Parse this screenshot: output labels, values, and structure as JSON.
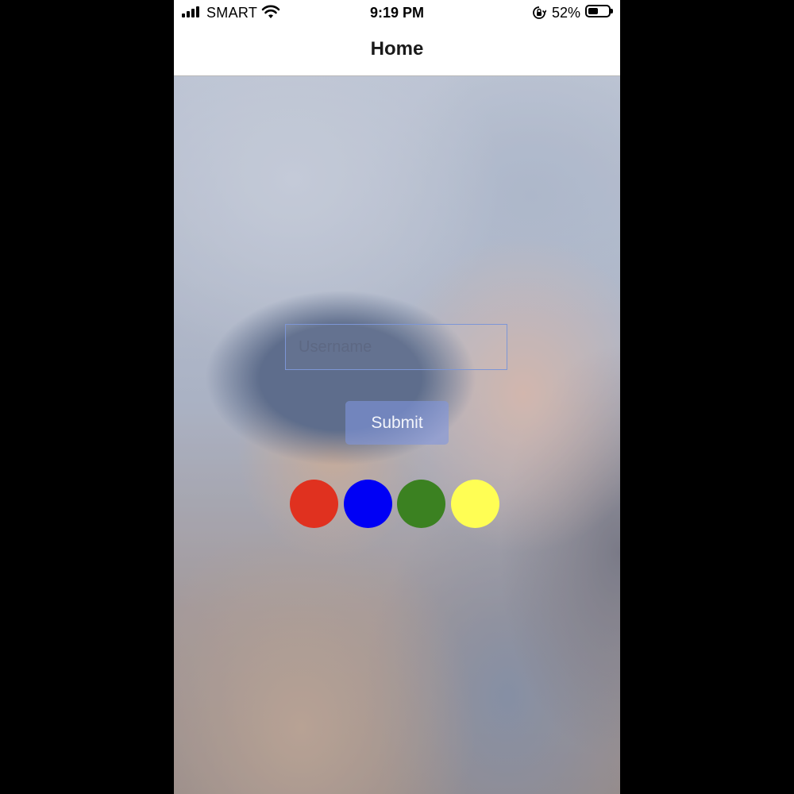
{
  "status_bar": {
    "carrier": "SMART",
    "time": "9:19 PM",
    "battery_percent": "52%",
    "battery_level": 0.52,
    "icons": [
      "signal-icon",
      "wifi-icon",
      "rotation-lock-icon",
      "battery-icon"
    ]
  },
  "nav": {
    "title": "Home"
  },
  "form": {
    "username_placeholder": "Username",
    "username_value": "",
    "submit_label": "Submit"
  },
  "colors": {
    "swatches": [
      {
        "name": "red",
        "hex": "#e0311f"
      },
      {
        "name": "blue",
        "hex": "#0000f5"
      },
      {
        "name": "green",
        "hex": "#3b8121"
      },
      {
        "name": "yellow",
        "hex": "#fffe54"
      }
    ],
    "input_border": "#7d96d6",
    "button_bg": "#8096de"
  }
}
